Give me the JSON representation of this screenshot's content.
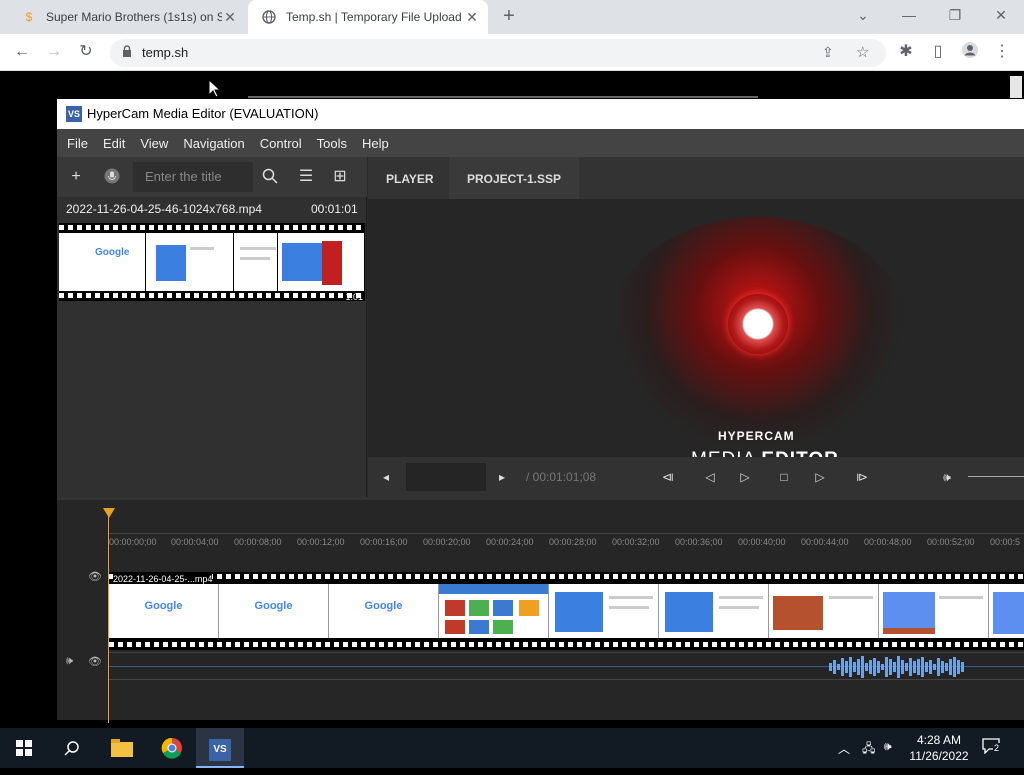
{
  "browser": {
    "tabs": [
      {
        "title": "Super Mario Brothers (1s1s) on S",
        "icon": "super-mario-favicon"
      },
      {
        "title": "Temp.sh | Temporary File Upload",
        "icon": "globe-icon"
      }
    ],
    "url": "temp.sh"
  },
  "app": {
    "title": "HyperCam Media Editor  (EVALUATION)",
    "icon_label": "VS",
    "menu": [
      "File",
      "Edit",
      "View",
      "Navigation",
      "Control",
      "Tools",
      "Help"
    ],
    "search_placeholder": "Enter the title",
    "media": {
      "filename": "2022-11-26-04-25-46-1024x768.mp4",
      "duration": "00:01:01",
      "thumb_duration": "1:01"
    },
    "player_tabs": [
      "PLAYER",
      "PROJECT-1.SSP"
    ],
    "logo": {
      "line1": "HYPERCAM",
      "line2_a": "MEDIA ",
      "line2_b": "EDITOR"
    },
    "transport": {
      "duration_label": "/ 00:01:01;08"
    },
    "timeline": {
      "ticks": [
        "00:00:00;00",
        "00:00:04;00",
        "00:00:08;00",
        "00:00:12;00",
        "00:00:16;00",
        "00:00:20;00",
        "00:00:24;00",
        "00:00:28;00",
        "00:00:32;00",
        "00:00:36;00",
        "00:00:40;00",
        "00:00:44;00",
        "00:00:48;00",
        "00:00:52;00",
        "00:00:5"
      ],
      "clip_label": "2022-11-26-04-25-...mp4",
      "frames": [
        "Google",
        "Google",
        "Google",
        "",
        "",
        "",
        "",
        "",
        "",
        ""
      ]
    }
  },
  "taskbar": {
    "time": "4:28 AM",
    "date": "11/26/2022",
    "notifications": "2"
  }
}
